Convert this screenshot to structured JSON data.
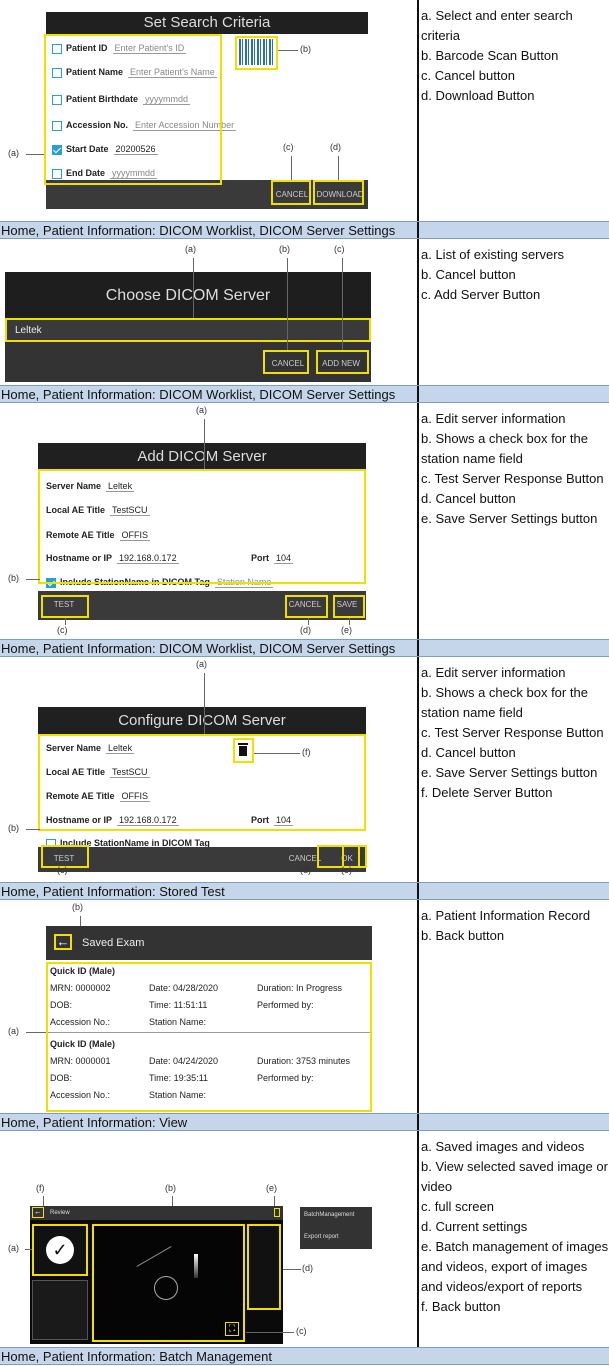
{
  "sections": [
    {
      "id": "search",
      "dialog_title": "Set Search Criteria",
      "fields": [
        {
          "label": "Patient ID",
          "value": "Enter Patient's ID",
          "placeholder": true,
          "checked": false
        },
        {
          "label": "Patient Name",
          "value": "Enter Patient's Name",
          "placeholder": true,
          "checked": false
        },
        {
          "label": "Patient Birthdate",
          "value": "yyyymmdd",
          "placeholder": true,
          "checked": false
        },
        {
          "label": "Accession No.",
          "value": "Enter Accession Number",
          "placeholder": true,
          "checked": false
        },
        {
          "label": "Start Date",
          "value": "20200526",
          "placeholder": false,
          "checked": true
        },
        {
          "label": "End Date",
          "value": "yyyymmdd",
          "placeholder": true,
          "checked": false
        }
      ],
      "buttons": [
        "CANCEL",
        "DOWNLOAD"
      ],
      "callouts": [
        "(a)",
        "(b)",
        "(c)",
        "(d)"
      ],
      "descriptions": [
        "a. Select and enter search criteria",
        "b. Barcode Scan Button",
        "c. Cancel button",
        "d. Download Button"
      ]
    },
    {
      "id": "choose",
      "header": "Home, Patient Information: DICOM Worklist, DICOM Server Settings",
      "dialog_title": "Choose DICOM Server",
      "server": "Leltek",
      "buttons": [
        "CANCEL",
        "ADD NEW"
      ],
      "callouts": [
        "(a)",
        "(b)",
        "(c)"
      ],
      "descriptions": [
        "a. List of existing servers",
        "b. Cancel button",
        "c. Add Server Button"
      ]
    },
    {
      "id": "add",
      "header": "Home, Patient Information: DICOM Worklist, DICOM Server Settings",
      "dialog_title": "Add DICOM Server",
      "server_name_label": "Server Name",
      "server_name": "Leltek",
      "local_ae_label": "Local AE Title",
      "local_ae": "TestSCU",
      "remote_ae_label": "Remote AE Title",
      "remote_ae": "OFFIS",
      "host_label": "Hostname or IP",
      "host": "192.168.0.172",
      "port_label": "Port",
      "port": "104",
      "station_label": "Include StationName in DICOM Tag",
      "station_placeholder": "Station Name",
      "buttons": [
        "TEST",
        "CANCEL",
        "SAVE"
      ],
      "callouts": [
        "(a)",
        "(b)",
        "(c)",
        "(d)",
        "(e)"
      ],
      "descriptions": [
        "a. Edit server information",
        "b. Shows a check box for the station name field",
        "c. Test Server Response Button",
        "d. Cancel button",
        "e. Save Server Settings button"
      ]
    },
    {
      "id": "configure",
      "header": "Home, Patient Information: DICOM Worklist, DICOM Server Settings",
      "dialog_title": "Configure DICOM Server",
      "server_name_label": "Server Name",
      "server_name": "Leltek",
      "local_ae_label": "Local AE Title",
      "local_ae": "TestSCU",
      "remote_ae_label": "Remote AE Title",
      "remote_ae": "OFFIS",
      "host_label": "Hostname or IP",
      "host": "192.168.0.172",
      "port_label": "Port",
      "port": "104",
      "station_label": "Include StationName in DICOM Tag",
      "buttons": [
        "TEST",
        "CANCEL",
        "OK"
      ],
      "callouts": [
        "(a)",
        "(b)",
        "(c)",
        "(d)",
        "(e)",
        "(f)"
      ],
      "descriptions": [
        "a. Edit server information",
        "b. Shows a check box for the station name field",
        "c. Test Server Response Button",
        "d. Cancel button",
        "e. Save Server Settings button",
        "f. Delete Server Button"
      ]
    },
    {
      "id": "saved",
      "header": "Home, Patient Information: Stored Test",
      "title": "Saved Exam",
      "records": [
        {
          "name": "Quick ID  (Male)",
          "mrn": "MRN: 0000002",
          "date": "Date: 04/28/2020",
          "duration": "Duration: In Progress",
          "dob": "DOB:",
          "time": "Time: 11:51:11",
          "performed": "Performed by:",
          "accession": "Accession No.:",
          "station": "Station Name:"
        },
        {
          "name": "Quick ID  (Male)",
          "mrn": "MRN: 0000001",
          "date": "Date: 04/24/2020",
          "duration": "Duration: 3753 minutes",
          "dob": "DOB:",
          "time": "Time: 19:35:11",
          "performed": "Performed by:",
          "accession": "Accession No.:",
          "station": "Station Name:"
        }
      ],
      "callouts": [
        "(a)",
        "(b)"
      ],
      "descriptions": [
        "a. Patient Information Record",
        "b. Back button"
      ]
    },
    {
      "id": "view",
      "header": "Home, Patient Information: View",
      "title": "Review",
      "menu": [
        "BatchManagement",
        "Export report"
      ],
      "callouts": [
        "(a)",
        "(b)",
        "(c)",
        "(d)",
        "(e)",
        "(f)"
      ],
      "descriptions": [
        "a. Saved images and videos",
        "b. View selected saved image or video",
        "c. full screen",
        "d. Current settings",
        "e. Batch management of images and videos, export of images and videos/export of reports",
        "f. Back button"
      ]
    }
  ],
  "footer_header": "Home, Patient Information: Batch Management"
}
